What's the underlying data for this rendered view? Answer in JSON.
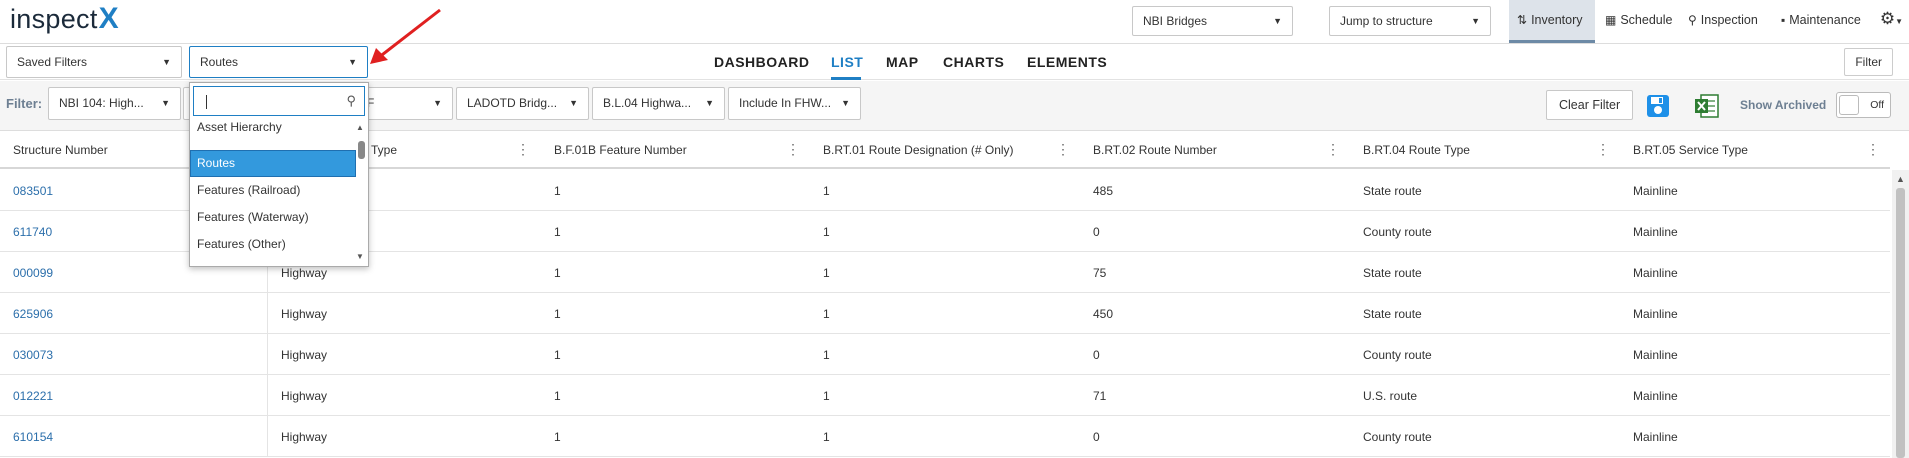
{
  "app": {
    "logo_text": "inspect",
    "logo_x": "X"
  },
  "topbar": {
    "asset_select": "NBI Bridges",
    "jump_select": "Jump to structure",
    "tabs": [
      {
        "label": "Inventory",
        "icon": "sort-icon"
      },
      {
        "label": "Schedule",
        "icon": "calendar-icon"
      },
      {
        "label": "Inspection",
        "icon": "search-icon"
      },
      {
        "label": "Maintenance",
        "icon": "toolbox-icon"
      }
    ]
  },
  "bar2": {
    "saved_filters": "Saved Filters",
    "view_select": "Routes",
    "nav": [
      "DASHBOARD",
      "LIST",
      "MAP",
      "CHARTS",
      "ELEMENTS"
    ],
    "active_nav": "LIST",
    "filter_button": "Filter"
  },
  "filters": {
    "label": "Filter:",
    "chips": [
      "NBI 104: High...",
      "F",
      "LADOTD Bridg...",
      "B.L.04 Highwa...",
      "Include In FHW..."
    ],
    "clear_button": "Clear Filter",
    "show_archived": "Show Archived",
    "toggle_state": "Off"
  },
  "dropdown": {
    "search_value": "",
    "items": [
      "Asset Hierarchy",
      "Routes",
      "Features (Railroad)",
      "Features (Waterway)",
      "Features (Other)"
    ],
    "selected": "Routes"
  },
  "table": {
    "columns": [
      "Structure Number",
      "Type",
      "B.F.01B Feature Number",
      "B.RT.01 Route Designation (# Only)",
      "B.RT.02 Route Number",
      "B.RT.04 Route Type",
      "B.RT.05 Service Type"
    ],
    "rows": [
      [
        "083501",
        "",
        "1",
        "1",
        "485",
        "State route",
        "Mainline"
      ],
      [
        "611740",
        "",
        "1",
        "1",
        "0",
        "County route",
        "Mainline"
      ],
      [
        "000099",
        "Highway",
        "1",
        "1",
        "75",
        "State route",
        "Mainline"
      ],
      [
        "625906",
        "Highway",
        "1",
        "1",
        "450",
        "State route",
        "Mainline"
      ],
      [
        "030073",
        "Highway",
        "1",
        "1",
        "0",
        "County route",
        "Mainline"
      ],
      [
        "012221",
        "Highway",
        "1",
        "1",
        "71",
        "U.S. route",
        "Mainline"
      ],
      [
        "610154",
        "Highway",
        "1",
        "1",
        "0",
        "County route",
        "Mainline"
      ]
    ]
  },
  "colors": {
    "accent": "#1f7fc4",
    "link": "#2c6fab",
    "annotation_arrow": "#e02020"
  }
}
